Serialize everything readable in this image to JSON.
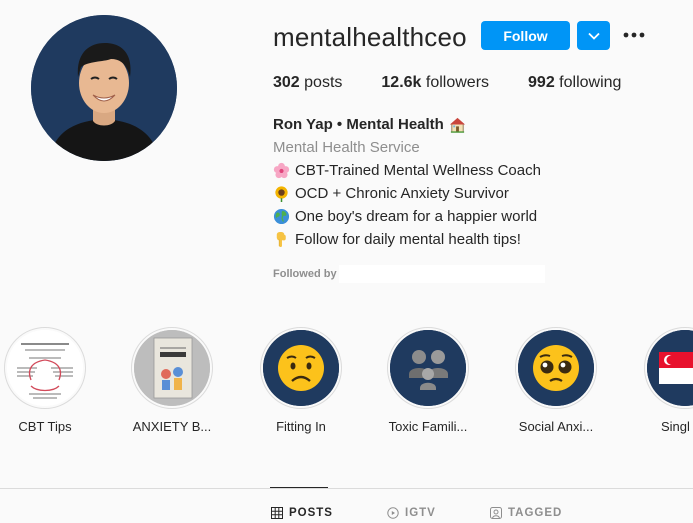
{
  "profile": {
    "username": "mentalhealthceo",
    "follow_label": "Follow",
    "stats": {
      "posts_count": "302",
      "posts_label": " posts",
      "followers_count": "12.6k",
      "followers_label": " followers",
      "following_count": "992",
      "following_label": " following"
    },
    "bio": {
      "name": "Ron Yap • Mental Health",
      "category": "Mental Health Service",
      "lines": [
        "CBT-Trained Mental Wellness Coach",
        "OCD + Chronic Anxiety Survivor",
        "One boy's dream for a happier world",
        "Follow for daily mental health tips!"
      ]
    },
    "followed_by_label": "Followed by"
  },
  "highlights": [
    {
      "label": "CBT Tips"
    },
    {
      "label": "ANXIETY B..."
    },
    {
      "label": "Fitting In"
    },
    {
      "label": "Toxic Famili..."
    },
    {
      "label": "Social Anxi..."
    },
    {
      "label": "Singl"
    }
  ],
  "tabs": {
    "posts": "POSTS",
    "igtv": "IGTV",
    "tagged": "TAGGED"
  },
  "colors": {
    "accent": "#0095f6",
    "secondary_text": "#8e8e8e",
    "avatar_bg": "#1f3a5f"
  }
}
